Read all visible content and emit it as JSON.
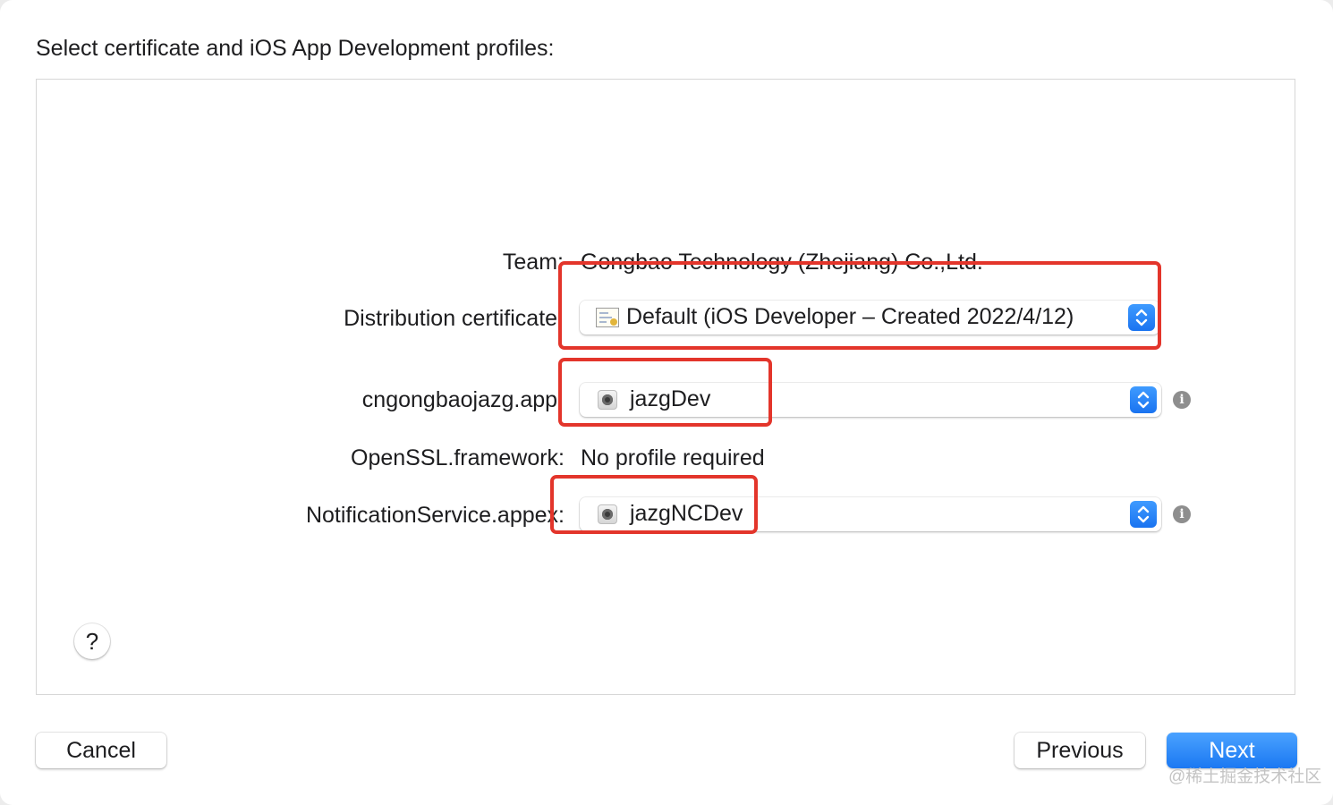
{
  "dialog": {
    "heading": "Select certificate and iOS App Development profiles:"
  },
  "rows": {
    "team": {
      "label": "Team:",
      "value": "Gongbao Technology (Zhejiang) Co.,Ltd."
    },
    "certificate": {
      "label": "Distribution certificate:",
      "selected": "Default (iOS Developer – Created 2022/4/12)"
    },
    "app": {
      "label": "cngongbaojazg.app:",
      "selected": "jazgDev"
    },
    "framework": {
      "label": "OpenSSL.framework:",
      "value": "No profile required"
    },
    "appex": {
      "label": "NotificationService.appex:",
      "selected": "jazgNCDev"
    }
  },
  "help": {
    "label": "?"
  },
  "buttons": {
    "cancel": "Cancel",
    "previous": "Previous",
    "next": "Next"
  },
  "info_icon_glyph": "i",
  "watermark": "@稀土掘金技术社区",
  "colors": {
    "accent": "#1b78f2",
    "annotation": "#e3352b"
  }
}
